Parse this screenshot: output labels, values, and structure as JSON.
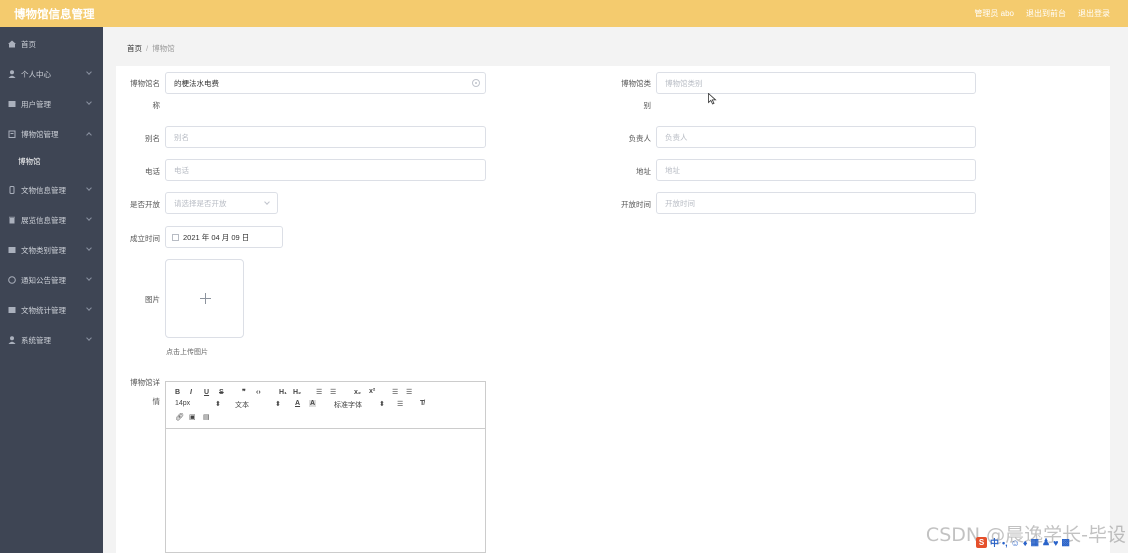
{
  "app": {
    "title": "博物馆信息管理"
  },
  "header": {
    "admin": "管理员 abo",
    "back_to_front": "退出到前台",
    "logout": "退出登录"
  },
  "sidebar": {
    "items": [
      {
        "label": "首页"
      },
      {
        "label": "个人中心"
      },
      {
        "label": "用户管理"
      },
      {
        "label": "博物馆管理"
      },
      {
        "label": "文物信息管理"
      },
      {
        "label": "展览信息管理"
      },
      {
        "label": "文物类别管理"
      },
      {
        "label": "通知公告管理"
      },
      {
        "label": "文物统计管理"
      },
      {
        "label": "系统管理"
      }
    ],
    "sub_item": "博物馆"
  },
  "breadcrumb": {
    "home": "首页",
    "sep": "/",
    "current": "博物馆"
  },
  "form": {
    "name_label_1": "博物馆名",
    "name_label_2": "称",
    "name_value": "的梗法水电费",
    "category_label_1": "博物馆类",
    "category_label_2": "别",
    "category_placeholder": "博物馆类别",
    "alias_label": "别名",
    "alias_placeholder": "别名",
    "manager_label": "负责人",
    "manager_placeholder": "负责人",
    "phone_label": "电话",
    "phone_placeholder": "电话",
    "address_label": "地址",
    "address_placeholder": "地址",
    "open_label": "是否开放",
    "open_placeholder": "请选择是否开放",
    "open_time_label": "开放时间",
    "open_time_placeholder": "开放时间",
    "founded_label": "成立时间",
    "founded_value": "2021 年 04 月 09 日",
    "image_label": "图片",
    "upload_tip": "点击上传图片",
    "detail_label_1": "博物馆详",
    "detail_label_2": "情"
  },
  "editor": {
    "font_size": "14px",
    "text_style": "文本",
    "font_family": "标准字体"
  },
  "watermark": "CSDN @晨逸学长-毕设",
  "colors": {
    "header": "#f4cb6e",
    "sidebar": "#3e4554"
  }
}
